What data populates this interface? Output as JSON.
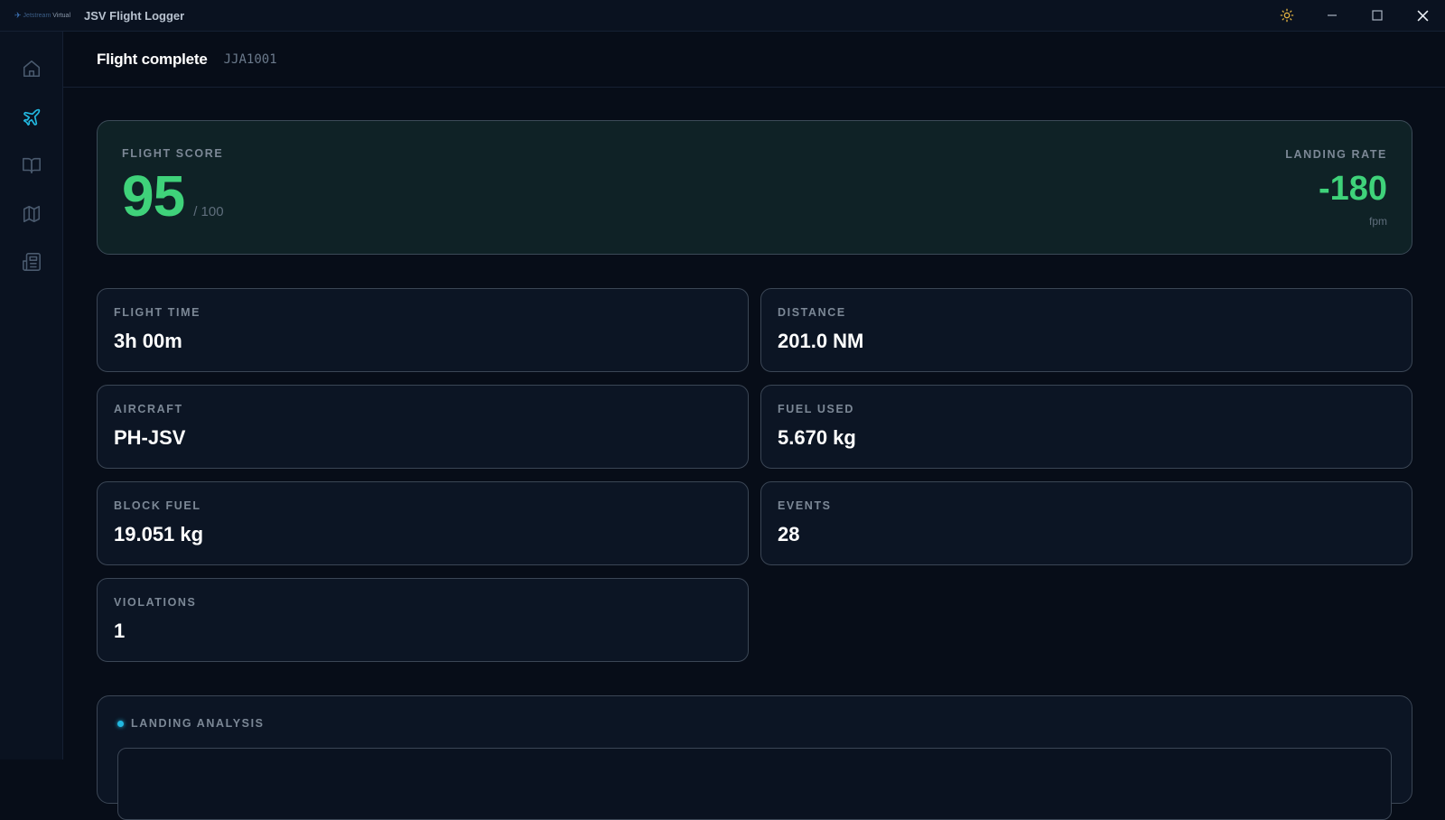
{
  "titlebar": {
    "brand_text": "Jetstream",
    "brand_suffix": "Virtual",
    "app_title": "JSV Flight Logger",
    "controls": {
      "theme": "sun-icon",
      "minimize": "minimize-icon",
      "maximize": "maximize-icon",
      "close": "close-icon"
    }
  },
  "sidebar": {
    "items": [
      {
        "name": "home",
        "icon": "home-icon",
        "active": false
      },
      {
        "name": "flights",
        "icon": "plane-icon",
        "active": true
      },
      {
        "name": "logbook",
        "icon": "book-open-icon",
        "active": false
      },
      {
        "name": "map",
        "icon": "map-icon",
        "active": false
      },
      {
        "name": "news",
        "icon": "newspaper-icon",
        "active": false
      }
    ]
  },
  "header": {
    "title": "Flight complete",
    "flight_id": "JJA1001"
  },
  "score": {
    "label": "FLIGHT SCORE",
    "value": "95",
    "max": "/ 100",
    "landing_label": "LANDING RATE",
    "landing_value": "-180",
    "landing_unit": "fpm"
  },
  "stats": [
    {
      "label": "FLIGHT TIME",
      "value": "3h 00m"
    },
    {
      "label": "DISTANCE",
      "value": "201.0 NM"
    },
    {
      "label": "AIRCRAFT",
      "value": "PH-JSV"
    },
    {
      "label": "FUEL USED",
      "value": "5.670 kg"
    },
    {
      "label": "BLOCK FUEL",
      "value": "19.051 kg"
    },
    {
      "label": "EVENTS",
      "value": "28"
    },
    {
      "label": "VIOLATIONS",
      "value": "1"
    }
  ],
  "analysis": {
    "label": "LANDING ANALYSIS"
  },
  "colors": {
    "accent": "#22b8e0",
    "score_green": "#3fd27a",
    "background": "#070d18"
  }
}
